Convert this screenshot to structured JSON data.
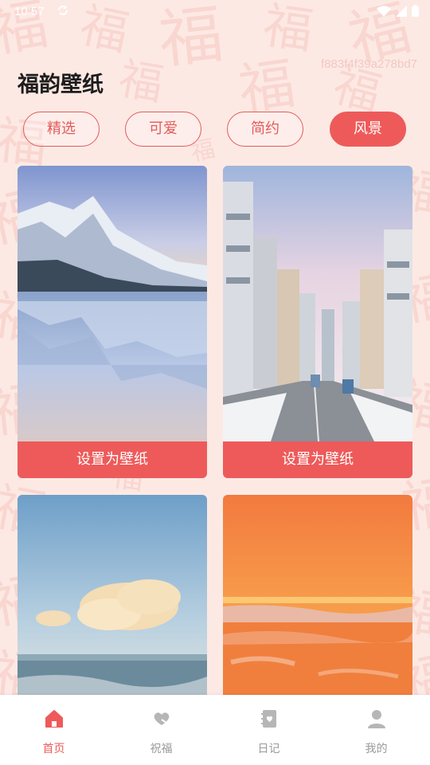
{
  "status_bar": {
    "time": "10:57"
  },
  "watermark": "f883f4f39a278bd7",
  "page_title": "福韵壁纸",
  "tabs": [
    {
      "label": "精选",
      "active": false
    },
    {
      "label": "可爱",
      "active": false
    },
    {
      "label": "简约",
      "active": false
    },
    {
      "label": "风景",
      "active": true
    }
  ],
  "wallpapers": [
    {
      "scene": "snowy mountain lake reflection",
      "button": "设置为壁纸"
    },
    {
      "scene": "snowy city street with tram",
      "button": "设置为壁纸"
    },
    {
      "scene": "calm sea with cloud at dusk"
    },
    {
      "scene": "orange sunset over sea"
    }
  ],
  "bottom_nav": [
    {
      "label": "首页",
      "icon": "home-icon",
      "active": true
    },
    {
      "label": "祝福",
      "icon": "heart-hand-icon",
      "active": false
    },
    {
      "label": "日记",
      "icon": "diary-icon",
      "active": false
    },
    {
      "label": "我的",
      "icon": "user-icon",
      "active": false
    }
  ],
  "colors": {
    "accent": "#ee5a5a",
    "background": "#fde9e4",
    "inactive": "#9a9a9a"
  }
}
